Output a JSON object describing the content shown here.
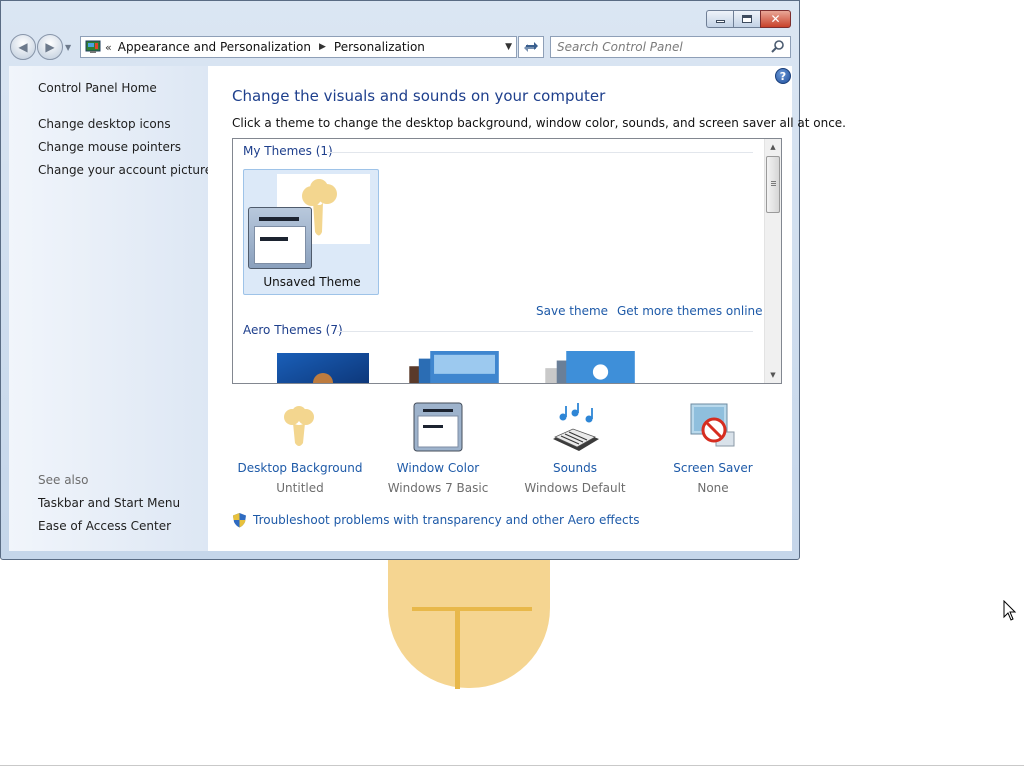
{
  "window": {
    "caption_buttons": [
      "minimize",
      "maximize",
      "close"
    ]
  },
  "nav": {
    "address": {
      "chevron": "«",
      "crumbs": [
        "Appearance and Personalization",
        "Personalization"
      ]
    },
    "search": {
      "placeholder": "Search Control Panel"
    }
  },
  "sidebar": {
    "home": "Control Panel Home",
    "tasks": [
      "Change desktop icons",
      "Change mouse pointers",
      "Change your account picture"
    ],
    "see_also_header": "See also",
    "see_also": [
      "Taskbar and Start Menu",
      "Ease of Access Center"
    ]
  },
  "main": {
    "title": "Change the visuals and sounds on your computer",
    "description": "Click a theme to change the desktop background, window color, sounds, and screen saver all at once.",
    "themes": {
      "my_themes_header": "My Themes (1)",
      "selected_theme": "Unsaved Theme",
      "save_link": "Save theme",
      "more_link": "Get more themes online",
      "aero_header": "Aero Themes (7)"
    },
    "settings": [
      {
        "label": "Desktop Background",
        "value": "Untitled",
        "icon": "desktop-background-icon"
      },
      {
        "label": "Window Color",
        "value": "Windows 7 Basic",
        "icon": "window-color-icon"
      },
      {
        "label": "Sounds",
        "value": "Windows Default",
        "icon": "sounds-icon"
      },
      {
        "label": "Screen Saver",
        "value": "None",
        "icon": "screen-saver-icon"
      }
    ],
    "troubleshoot": "Troubleshoot problems with transparency and other Aero effects"
  },
  "colors": {
    "link": "#1e5aa8",
    "heading": "#1e3f8c",
    "selection": "#dce9f8",
    "wallpaper_blob": "#f5d591"
  }
}
